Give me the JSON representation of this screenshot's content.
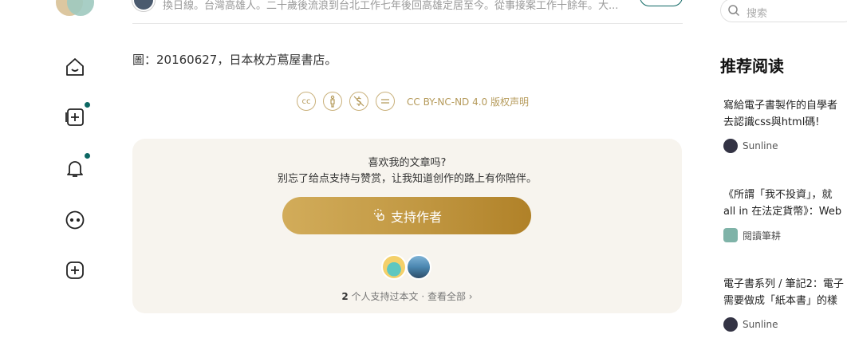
{
  "author": {
    "bio": "換日線。台灣高雄人。二十歲後流浪到台北工作七年後回高雄定居至今。從事接案工作十餘年。大..."
  },
  "article": {
    "caption": "圖：20160627，日本枚方蔦屋書店。",
    "license_icons": [
      "cc",
      "by",
      "nc",
      "nd"
    ],
    "license_text": "CC BY-NC-ND 4.0 版权声明"
  },
  "support": {
    "question": "喜欢我的文章吗?",
    "subtitle": "别忘了给点支持与赞赏，让我知道创作的路上有你陪伴。",
    "button_label": "支持作者",
    "count": "2",
    "count_suffix": " 个人支持过本文 · 查看全部 ›"
  },
  "sidebar": {
    "search_placeholder": "搜索",
    "recommend_title": "推荐阅读",
    "items": [
      {
        "line1": "寫給電子書製作的自學者",
        "line2": "去認識css與html碼!",
        "author": "Sunline"
      },
      {
        "line1": "《所謂「我不投資」，就",
        "line2": "all in 在法定貨幣》：Web",
        "author": "閱讀筆耕"
      },
      {
        "line1": "電子書系列 / 筆記2：電子",
        "line2": "需要做成「紙本書」的樣",
        "author": "Sunline"
      }
    ]
  },
  "colors": {
    "accent": "#0d6763",
    "gold": "#c39a45",
    "card_bg": "#f7f4ee"
  }
}
